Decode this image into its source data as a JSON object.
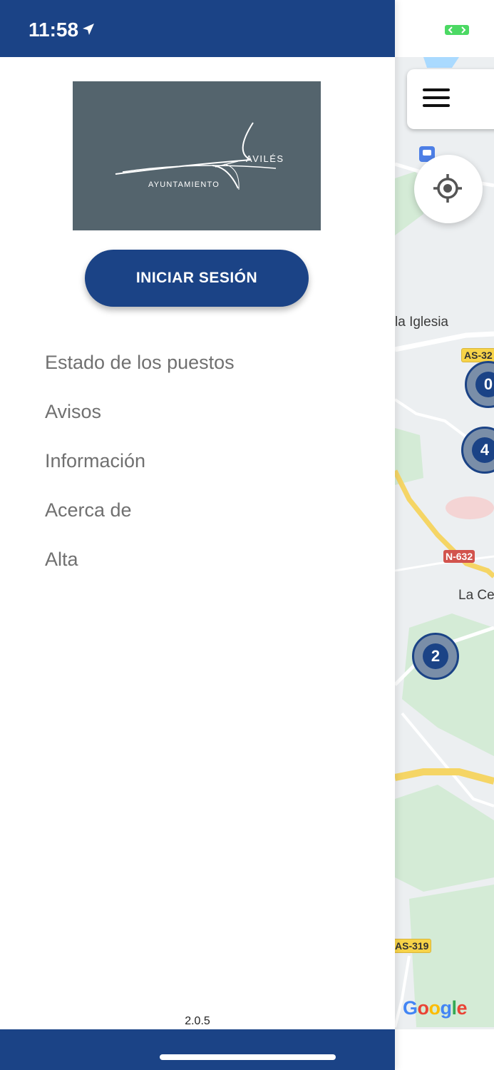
{
  "status_bar": {
    "time": "11:58",
    "location_icon": "location-arrow-icon",
    "battery_icon": "battery-charging-icon"
  },
  "drawer": {
    "logo": {
      "top_text": "AVILÉS",
      "bottom_text": "AYUNTAMIENTO"
    },
    "login_button": "INICIAR SESIÓN",
    "menu_items": [
      {
        "label": "Estado de los puestos"
      },
      {
        "label": "Avisos"
      },
      {
        "label": "Información"
      },
      {
        "label": "Acerca de"
      },
      {
        "label": "Alta"
      }
    ],
    "version": "2.0.5"
  },
  "map": {
    "menu_icon": "hamburger-menu-icon",
    "locate_icon": "my-location-icon",
    "labels": {
      "iglesia": "la Iglesia",
      "town": "La Ce"
    },
    "roads": {
      "as320": "AS-32",
      "n632": "N-632",
      "as319": "AS-319"
    },
    "clusters": [
      {
        "count": "0"
      },
      {
        "count": "4"
      },
      {
        "count": "2"
      }
    ],
    "attribution": "Google"
  },
  "colors": {
    "brand": "#1b4386",
    "logo_background": "#54646d",
    "menu_text": "#707070"
  }
}
